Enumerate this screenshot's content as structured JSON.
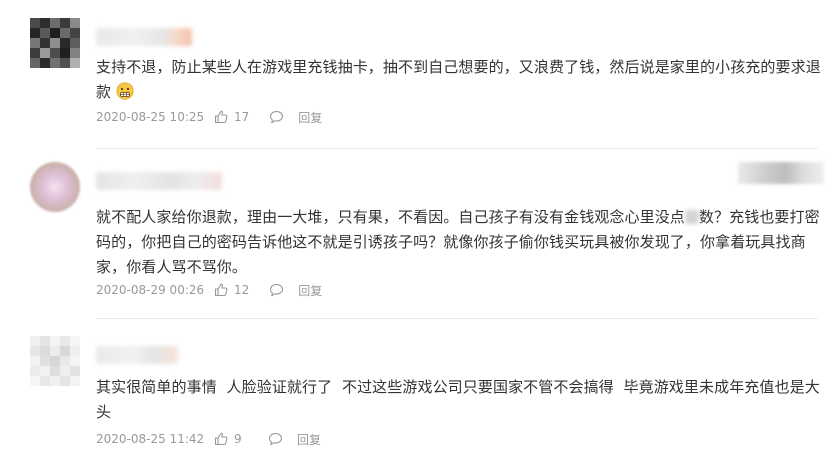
{
  "comments": [
    {
      "text": "支持不退，防止某些人在游戏里充钱抽卡，抽不到自己想要的，又浪费了钱，然后说是家里的小孩充的要求退款",
      "timestamp": "2020-08-25 10:25",
      "likes": "17",
      "reply_label": "回复"
    },
    {
      "text_before": "就不配人家给你退款，理由一大堆，只有果，不看因。自己孩子有没有金钱观念心里没点",
      "text_after": "数？充钱也要打密码的，你把自己的密码告诉他这不就是引诱孩子吗？就像你孩子偷你钱买玩具被你发现了，你拿着玩具找商家，你看人骂不骂你。",
      "timestamp": "2020-08-29 00:26",
      "likes": "12",
      "reply_label": "回复"
    },
    {
      "text": "其实很简单的事情  人脸验证就行了  不过这些游戏公司只要国家不管不会搞得  毕竟游戏里未成年充值也是大头",
      "timestamp": "2020-08-25 11:42",
      "likes": "9",
      "reply_label": "回复"
    }
  ],
  "icons": {
    "like": "thumbs-up-icon",
    "reply": "reply-bubble-icon",
    "emoji": "grimacing-face-emoji"
  },
  "colors": {
    "text": "#333333",
    "meta": "#999999",
    "divider": "#ececec"
  }
}
